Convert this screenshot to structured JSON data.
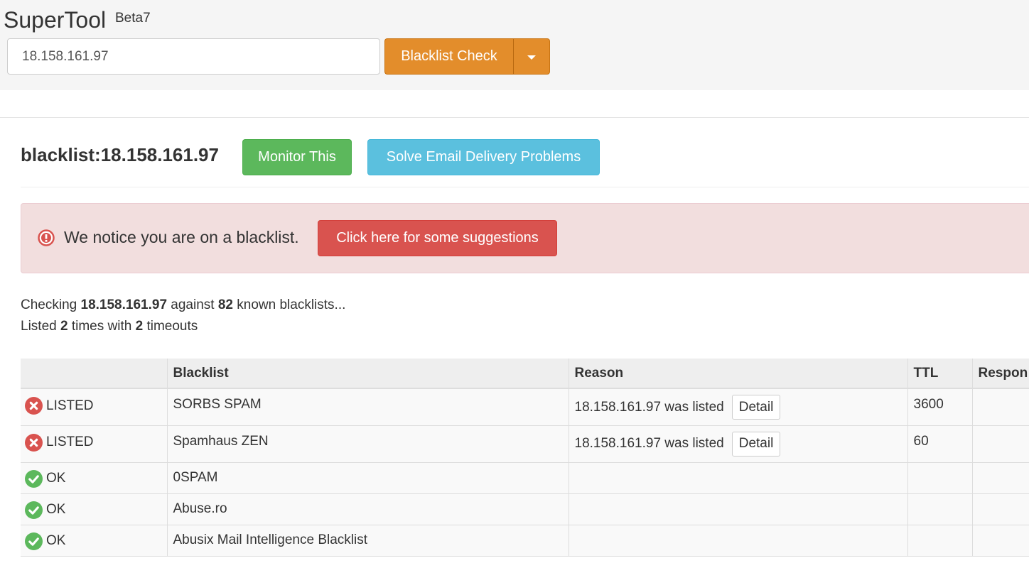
{
  "header": {
    "brand": "SuperTool",
    "beta": "Beta7",
    "search_value": "18.158.161.97",
    "check_button": "Blacklist Check"
  },
  "title": {
    "text": "blacklist:18.158.161.97",
    "monitor_button": "Monitor This",
    "solve_button": "Solve Email Delivery Problems"
  },
  "alert": {
    "text": "We notice you are on a blacklist.",
    "button": "Click here for some suggestions"
  },
  "summary": {
    "checking_prefix": "Checking",
    "ip": "18.158.161.97",
    "against": "against",
    "count": "82",
    "known": "known blacklists...",
    "listed_prefix": "Listed",
    "listed_count": "2",
    "times_with": "times with",
    "timeouts_count": "2",
    "timeouts": "timeouts"
  },
  "table": {
    "columns": [
      "",
      "Blacklist",
      "Reason",
      "TTL",
      "Respon"
    ],
    "rows": [
      {
        "status": "LISTED",
        "blacklist": "SORBS SPAM",
        "reason": "18.158.161.97 was listed",
        "detail": "Detail",
        "ttl": "3600",
        "response": ""
      },
      {
        "status": "LISTED",
        "blacklist": "Spamhaus ZEN",
        "reason": "18.158.161.97 was listed",
        "detail": "Detail",
        "ttl": "60",
        "response": ""
      },
      {
        "status": "OK",
        "blacklist": "0SPAM",
        "reason": "",
        "detail": "",
        "ttl": "",
        "response": ""
      },
      {
        "status": "OK",
        "blacklist": "Abuse.ro",
        "reason": "",
        "detail": "",
        "ttl": "",
        "response": ""
      },
      {
        "status": "OK",
        "blacklist": "Abusix Mail Intelligence Blacklist",
        "reason": "",
        "detail": "",
        "ttl": "",
        "response": ""
      }
    ]
  },
  "colors": {
    "orange": "#e38d2b",
    "green": "#5cb85c",
    "blue": "#5bc0de",
    "red": "#d9534f",
    "alert_bg": "#f2dede",
    "listed_icon": "#d9534f",
    "ok_icon": "#5cb85c"
  },
  "icons": {
    "caret": "chevron-down-icon",
    "alert": "exclamation-circle-icon",
    "listed": "x-circle-icon",
    "ok": "check-circle-icon"
  }
}
